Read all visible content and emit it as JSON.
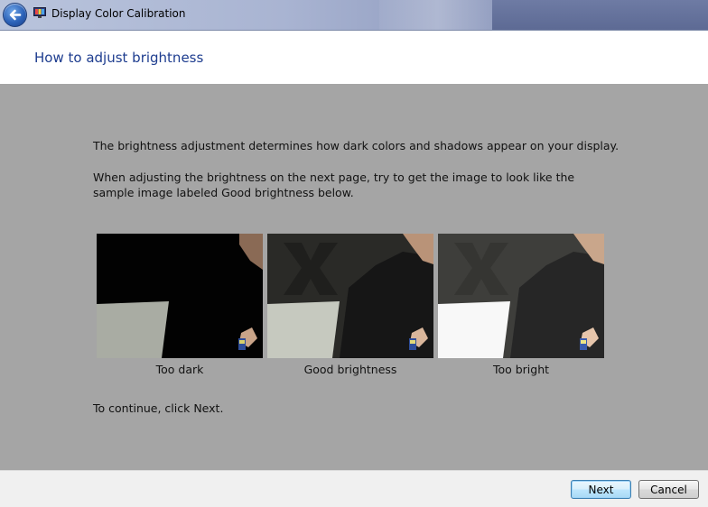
{
  "window": {
    "title": "Display Color Calibration",
    "app_icon": "display-calibration-icon",
    "back_icon": "back-arrow-icon"
  },
  "header": {
    "title": "How to adjust brightness"
  },
  "main": {
    "intro": "The brightness adjustment determines how dark colors and shadows appear on your display.",
    "instruction": "When adjusting the brightness on the next page, try to get the image to look like the sample image labeled Good brightness below.",
    "samples": [
      {
        "label": "Too dark"
      },
      {
        "label": "Good brightness"
      },
      {
        "label": "Too bright"
      }
    ],
    "continue_text": "To continue, click Next."
  },
  "footer": {
    "next_label": "Next",
    "cancel_label": "Cancel"
  },
  "colors": {
    "title_text": "#1e3d8f",
    "main_background": "#a5a5a5",
    "footer_background": "#f0f0f0"
  }
}
